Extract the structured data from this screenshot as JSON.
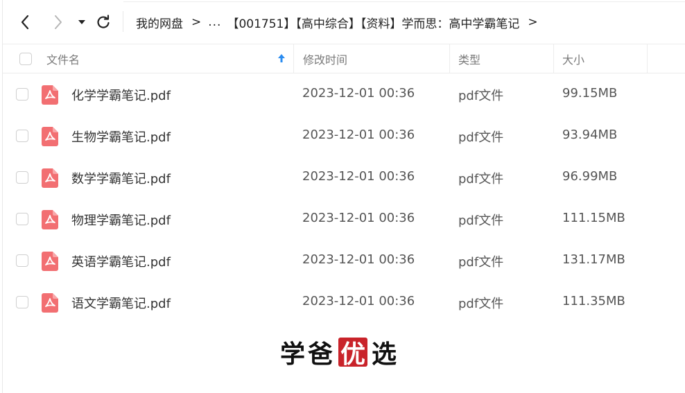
{
  "toolbar": {
    "back_icon": "chevron-left-icon",
    "forward_icon": "chevron-right-icon",
    "dropdown_icon": "caret-down-icon",
    "refresh_icon": "refresh-icon"
  },
  "breadcrumb": {
    "root": "我的网盘",
    "separator": ">",
    "ellipsis": "...",
    "current": "【001751】【高中综合】【资料】学而思：高中学霸笔记",
    "trailing_separator": ">"
  },
  "columns": {
    "name": "文件名",
    "time": "修改时间",
    "type": "类型",
    "size": "大小",
    "sort_icon": "arrow-up-icon"
  },
  "files": [
    {
      "name": "化学学霸笔记.pdf",
      "time": "2023-12-01 00:36",
      "type": "pdf文件",
      "size": "99.15MB"
    },
    {
      "name": "生物学霸笔记.pdf",
      "time": "2023-12-01 00:36",
      "type": "pdf文件",
      "size": "93.94MB"
    },
    {
      "name": "数学学霸笔记.pdf",
      "time": "2023-12-01 00:36",
      "type": "pdf文件",
      "size": "96.99MB"
    },
    {
      "name": "物理学霸笔记.pdf",
      "time": "2023-12-01 00:36",
      "type": "pdf文件",
      "size": "111.15MB"
    },
    {
      "name": "英语学霸笔记.pdf",
      "time": "2023-12-01 00:36",
      "type": "pdf文件",
      "size": "131.17MB"
    },
    {
      "name": "语文学霸笔记.pdf",
      "time": "2023-12-01 00:36",
      "type": "pdf文件",
      "size": "111.35MB"
    }
  ],
  "file_icon": "pdf-file-icon",
  "watermark": {
    "char1": "学",
    "char2": "爸",
    "char3": "优",
    "char4": "选"
  },
  "colors": {
    "pdf_icon": "#f26f72",
    "sort_arrow": "#2b8cf0",
    "seal": "#c9232a"
  }
}
